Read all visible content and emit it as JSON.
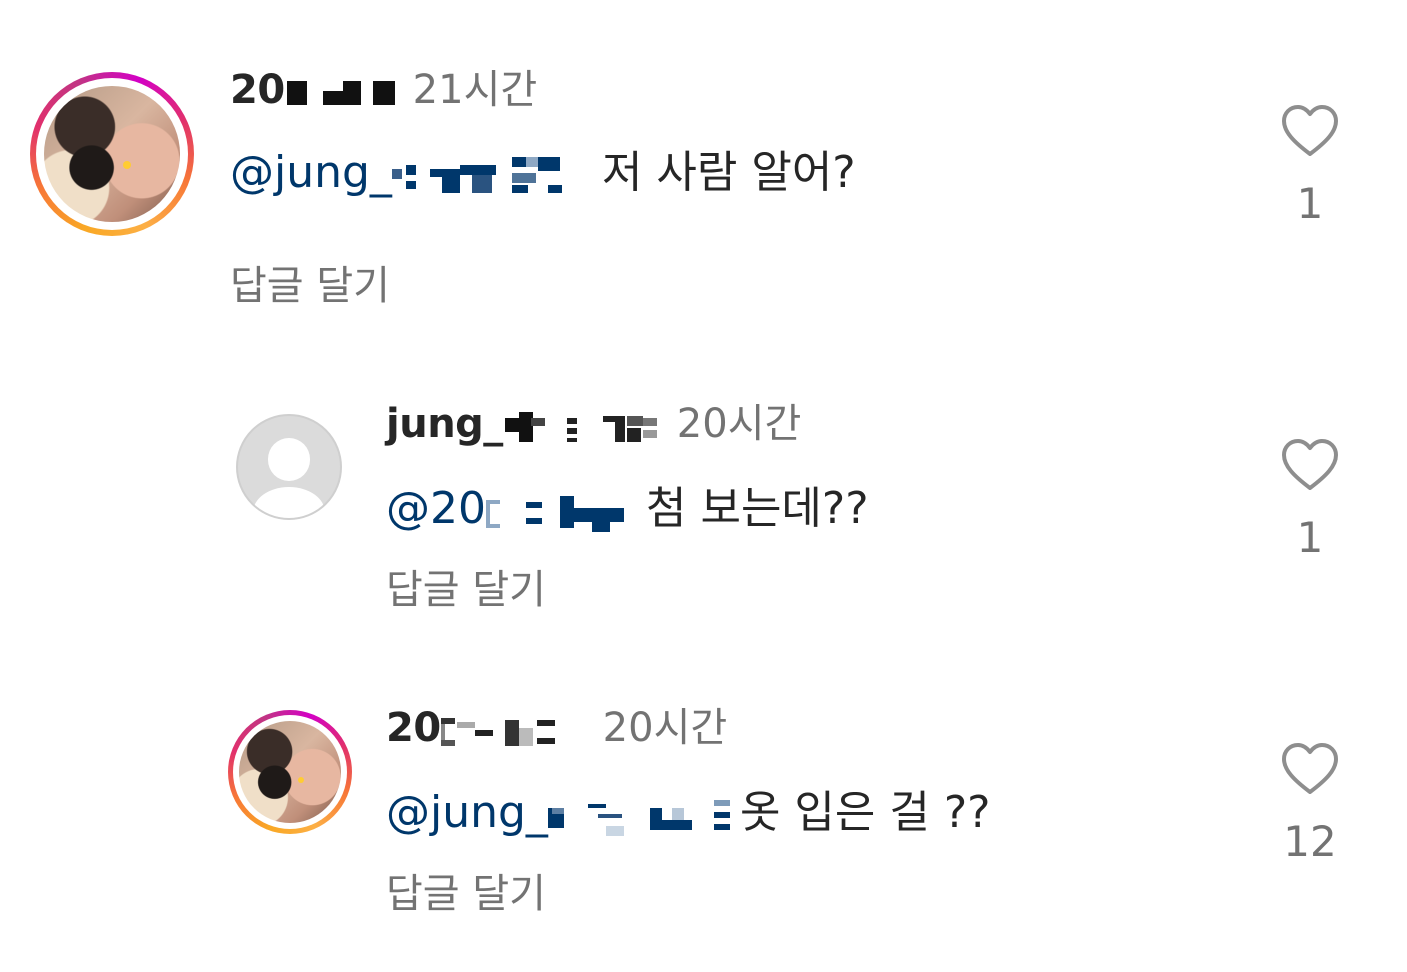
{
  "comments": [
    {
      "username": "20",
      "time": "21시간",
      "mention": "@jung_",
      "text": "저 사람 알어?",
      "reply_label": "답글 달기",
      "likes": "1",
      "avatar": "profile-photo",
      "story_ring": true
    },
    {
      "username": "jung_",
      "time": "20시간",
      "mention": "@20",
      "text": "첨 보는데??",
      "reply_label": "답글 달기",
      "likes": "1",
      "avatar": "default-avatar",
      "story_ring": false
    },
    {
      "username": "20",
      "time": "20시간",
      "mention": "@jung_",
      "text": "옷 입은 걸 ??",
      "reply_label": "답글 달기",
      "likes": "12",
      "avatar": "profile-photo",
      "story_ring": true
    }
  ],
  "icons": {
    "like": "heart-outline-icon"
  },
  "colors": {
    "mention": "#00376b",
    "secondary_text": "#737373",
    "primary_text": "#262626",
    "heart_stroke": "#8e8e8e"
  }
}
